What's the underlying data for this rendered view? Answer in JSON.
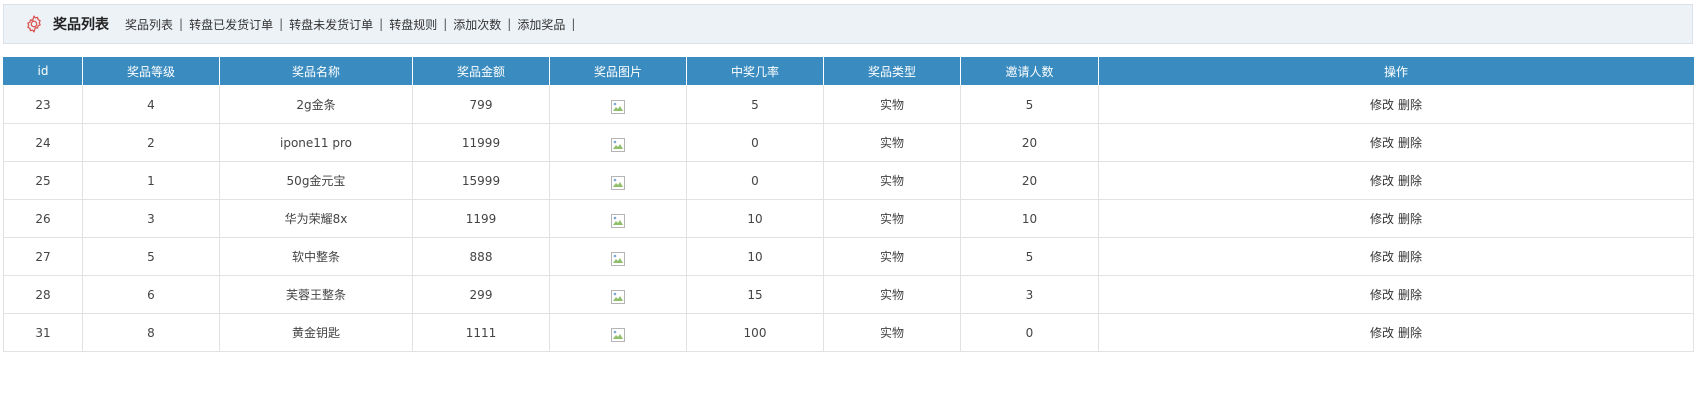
{
  "header": {
    "title": "奖品列表",
    "icon": "gear-icon",
    "accent": "#d9534f",
    "nav": [
      {
        "label": "奖品列表"
      },
      {
        "label": "转盘已发货订单"
      },
      {
        "label": "转盘未发货订单"
      },
      {
        "label": "转盘规则"
      },
      {
        "label": "添加次数"
      },
      {
        "label": "添加奖品"
      }
    ],
    "separator": "|"
  },
  "table": {
    "header_color": "#3a8cc0",
    "columns": [
      "id",
      "奖品等级",
      "奖品名称",
      "奖品金额",
      "奖品图片",
      "中奖几率",
      "奖品类型",
      "邀请人数",
      "操作"
    ],
    "rows": [
      {
        "id": "23",
        "level": "4",
        "name": "2g金条",
        "amount": "799",
        "image": "broken-image-icon",
        "rate": "5",
        "type": "实物",
        "invites": "5",
        "edit": "修改",
        "delete": "删除"
      },
      {
        "id": "24",
        "level": "2",
        "name": "ipone11 pro",
        "amount": "11999",
        "image": "broken-image-icon",
        "rate": "0",
        "type": "实物",
        "invites": "20",
        "edit": "修改",
        "delete": "删除"
      },
      {
        "id": "25",
        "level": "1",
        "name": "50g金元宝",
        "amount": "15999",
        "image": "broken-image-icon",
        "rate": "0",
        "type": "实物",
        "invites": "20",
        "edit": "修改",
        "delete": "删除"
      },
      {
        "id": "26",
        "level": "3",
        "name": "华为荣耀8x",
        "amount": "1199",
        "image": "broken-image-icon",
        "rate": "10",
        "type": "实物",
        "invites": "10",
        "edit": "修改",
        "delete": "删除"
      },
      {
        "id": "27",
        "level": "5",
        "name": "软中整条",
        "amount": "888",
        "image": "broken-image-icon",
        "rate": "10",
        "type": "实物",
        "invites": "5",
        "edit": "修改",
        "delete": "删除"
      },
      {
        "id": "28",
        "level": "6",
        "name": "芙蓉王整条",
        "amount": "299",
        "image": "broken-image-icon",
        "rate": "15",
        "type": "实物",
        "invites": "3",
        "edit": "修改",
        "delete": "删除"
      },
      {
        "id": "31",
        "level": "8",
        "name": "黄金钥匙",
        "amount": "1111",
        "image": "broken-image-icon",
        "rate": "100",
        "type": "实物",
        "invites": "0",
        "edit": "修改",
        "delete": "删除"
      }
    ]
  }
}
